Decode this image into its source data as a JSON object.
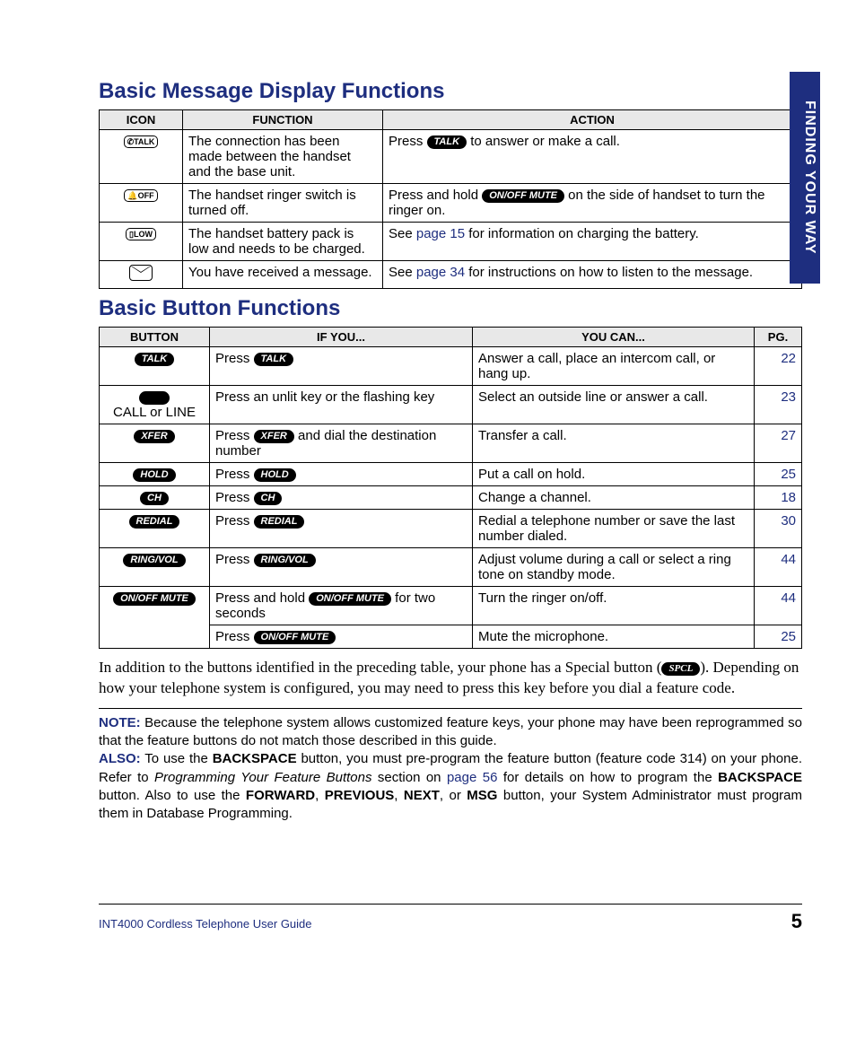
{
  "sideTab": "FINDING YOUR WAY",
  "section1": {
    "title": "Basic Message Display Functions",
    "headers": {
      "c1": "ICON",
      "c2": "FUNCTION",
      "c3": "ACTION"
    },
    "rows": [
      {
        "iconName": "talk-antenna-icon",
        "iconText": "✆TALK",
        "func": "The connection has been made between the handset and the base unit.",
        "action_pre": "Press ",
        "action_btn": "TALK",
        "action_post": " to answer or make a call."
      },
      {
        "iconName": "ringer-off-icon",
        "iconText": "🔔OFF",
        "func": "The handset ringer switch is turned off.",
        "action_pre": "Press and hold ",
        "action_btn": "ON/OFF MUTE",
        "action_post": " on the side of handset to turn the ringer on."
      },
      {
        "iconName": "battery-low-icon",
        "iconText": "▯LOW",
        "func": "The handset battery pack is low and needs to be charged.",
        "action_text_a": "See ",
        "action_link": "page 15",
        "action_text_b": " for information on charging the battery."
      },
      {
        "iconName": "message-envelope-icon",
        "iconEnvelope": true,
        "func": "You have received a message.",
        "action_text_a": "See ",
        "action_link": "page 34",
        "action_text_b": " for instructions on how to listen to the message."
      }
    ]
  },
  "section2": {
    "title": "Basic Button Functions",
    "headers": {
      "c1": "BUTTON",
      "c2": "IF YOU...",
      "c3": "YOU CAN...",
      "c4": "PG."
    },
    "rows": [
      {
        "btn": "TALK",
        "if_pre": "Press ",
        "if_btn": "TALK",
        "if_post": "",
        "can": "Answer a call, place an intercom call, or hang up.",
        "pg": "22"
      },
      {
        "btn_blank": true,
        "btn_label": "CALL or LINE",
        "if_text": "Press an unlit key or the flashing key",
        "can": "Select an outside line or answer a call.",
        "pg": "23"
      },
      {
        "btn": "XFER",
        "if_pre": "Press ",
        "if_btn": "XFER",
        "if_post": " and dial the destination number",
        "can": "Transfer a call.",
        "pg": "27"
      },
      {
        "btn": "HOLD",
        "if_pre": "Press ",
        "if_btn": "HOLD",
        "if_post": "",
        "can": "Put a call on hold.",
        "pg": "25"
      },
      {
        "btn": "CH",
        "if_pre": "Press ",
        "if_btn": "CH",
        "if_post": "",
        "can": "Change a channel.",
        "pg": "18"
      },
      {
        "btn": "REDIAL",
        "if_pre": "Press ",
        "if_btn": "REDIAL",
        "if_post": "",
        "can": "Redial a telephone number or save the last number dialed.",
        "pg": "30"
      },
      {
        "btn": "RING/VOL",
        "if_pre": "Press ",
        "if_btn": "RING/VOL",
        "if_post": "",
        "can": "Adjust volume during a call or select a ring tone on standby mode.",
        "pg": "44"
      },
      {
        "btn": "ON/OFF MUTE",
        "rowspan": 2,
        "if_pre": "Press and hold ",
        "if_btn": "ON/OFF MUTE",
        "if_post": " for two seconds",
        "can": "Turn the ringer on/off.",
        "pg": "44"
      },
      {
        "continuation": true,
        "if_pre": "Press ",
        "if_btn": "ON/OFF MUTE",
        "if_post": "",
        "can": "Mute the microphone.",
        "pg": "25"
      }
    ]
  },
  "paragraph": {
    "pre": "In addition to the buttons identified in the preceding table, your phone has a Special button (",
    "btn": "SPCL",
    "post": "). Depending on how your telephone system is configured, you may need to press this key before you dial a feature code."
  },
  "note": {
    "kw1": "NOTE:",
    "t1": " Because the telephone system allows customized feature keys, your phone may have been reprogrammed so that the feature buttons do not match those described in this guide.",
    "kw2": "ALSO:",
    "t2a": " To use the ",
    "b1": "BACKSPACE",
    "t2b": " button, you must pre-program the feature button (feature code 314) on your phone. Refer to ",
    "i1": "Programming Your Feature Buttons",
    "t2c": " section on ",
    "link": "page 56",
    "t2d": " for details on how to program the ",
    "b2": "BACKSPACE",
    "t2e": " button. Also to use the ",
    "b3": "FORWARD",
    "t2f": ", ",
    "b4": "PREVIOUS",
    "t2g": ", ",
    "b5": "NEXT",
    "t2h": ", or ",
    "b6": "MSG",
    "t2i": " button, your System Administrator must program them in Database Programming."
  },
  "footer": {
    "left": "INT4000 Cordless Telephone User Guide",
    "right": "5"
  }
}
